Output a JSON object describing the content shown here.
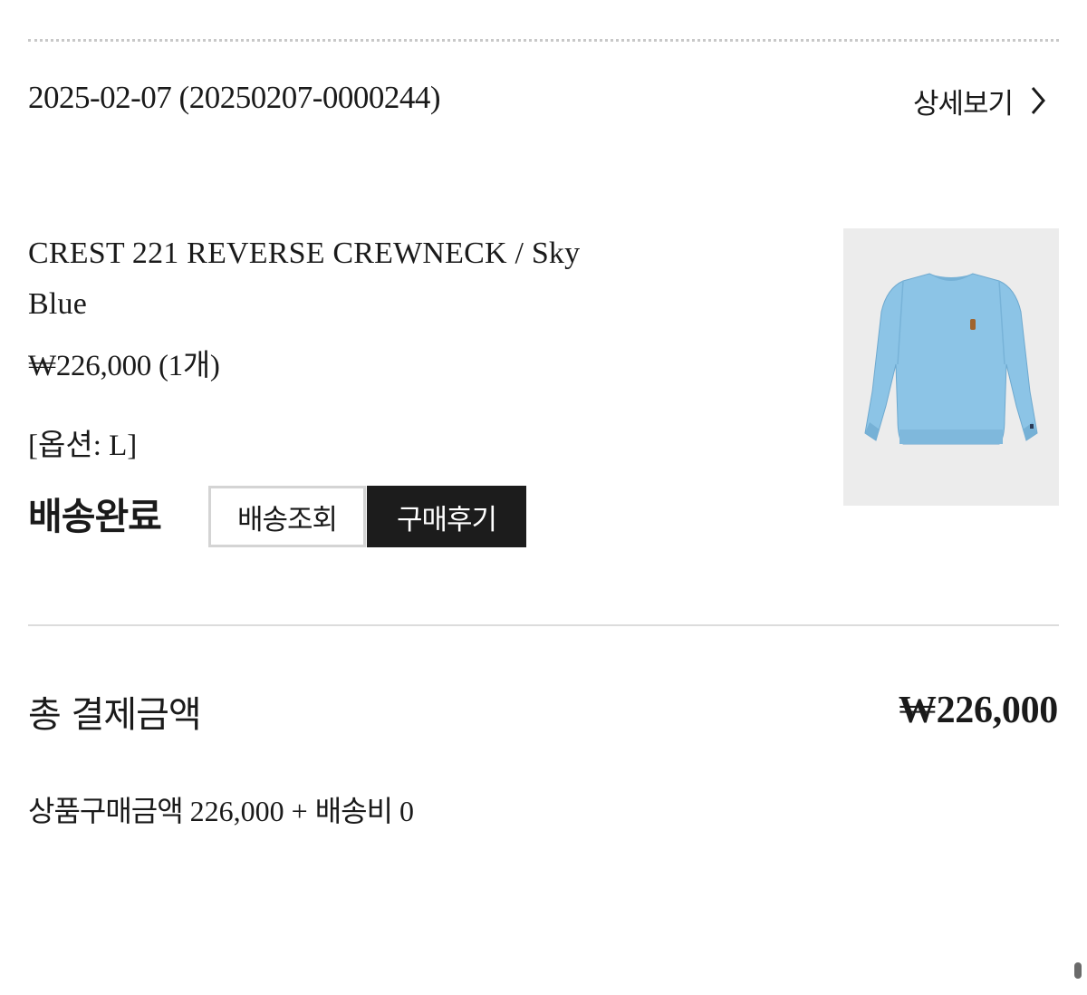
{
  "order": {
    "date_line": "2025-02-07 (20250207-0000244)",
    "detail_link_label": "상세보기"
  },
  "product": {
    "name": "CREST 221 REVERSE CREWNECK / Sky Blue",
    "price_line": "₩226,000 (1개)",
    "option_line": "[옵션: L]",
    "image_icon": "sky-blue-sweatshirt",
    "image_color": "#8cc4e6"
  },
  "status": {
    "label": "배송완료",
    "track_button": "배송조회",
    "review_button": "구매후기"
  },
  "summary": {
    "total_label": "총 결제금액",
    "total_value": "₩226,000",
    "goods_label": "상품구매금액",
    "goods_amount": "226,000",
    "plus_sign": "+",
    "shipping_label": "배송비",
    "shipping_amount": "0"
  },
  "colors": {
    "accent_dark": "#1c1c1c",
    "divider": "#dcdcdc"
  }
}
